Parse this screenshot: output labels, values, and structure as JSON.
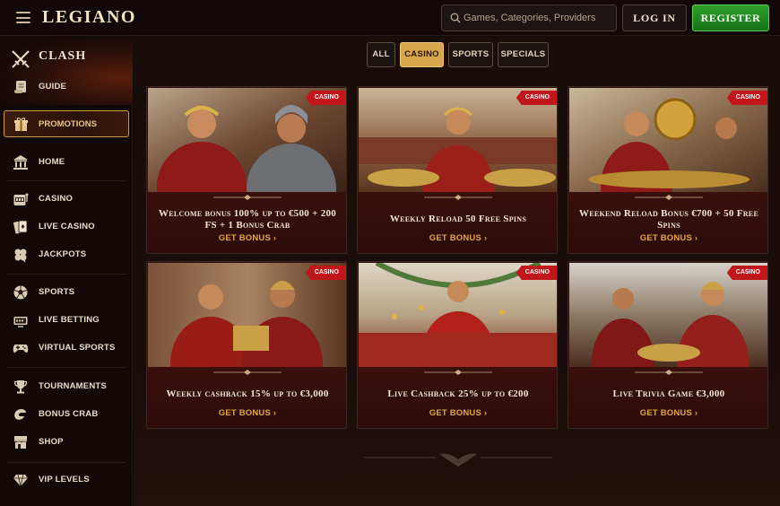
{
  "header": {
    "logo": "LEGIANO",
    "search_placeholder": "Games, Categories, Providers",
    "login_label": "LOG IN",
    "register_label": "REGISTER",
    "register_color": "#1f8a1d"
  },
  "sidebar": {
    "clash_label": "CLASH",
    "items": [
      {
        "label": "GUIDE",
        "icon": "scroll-icon"
      },
      {
        "label": "PROMOTIONS",
        "icon": "gift-icon",
        "active": true
      },
      {
        "label": "HOME",
        "icon": "temple-icon"
      },
      {
        "label": "CASINO",
        "icon": "slot-machine-icon"
      },
      {
        "label": "LIVE CASINO",
        "icon": "cards-icon"
      },
      {
        "label": "JACKPOTS",
        "icon": "clover-icon"
      },
      {
        "label": "SPORTS",
        "icon": "soccer-ball-icon"
      },
      {
        "label": "LIVE BETTING",
        "icon": "live-tv-icon"
      },
      {
        "label": "VIRTUAL SPORTS",
        "icon": "gamepad-icon"
      },
      {
        "label": "TOURNAMENTS",
        "icon": "trophy-icon"
      },
      {
        "label": "BONUS CRAB",
        "icon": "claw-icon"
      },
      {
        "label": "SHOP",
        "icon": "shop-icon"
      },
      {
        "label": "VIP LEVELS",
        "icon": "diamond-icon"
      }
    ]
  },
  "filters": [
    {
      "label": "ALL",
      "active": false
    },
    {
      "label": "CASINO",
      "active": true
    },
    {
      "label": "SPORTS",
      "active": false
    },
    {
      "label": "SPECIALS",
      "active": false
    }
  ],
  "promotions": [
    {
      "badge": "CASINO",
      "title": "Welcome bonus 100% up to €500 + 200 FS + 1 Bonus Crab",
      "cta": "GET BONUS"
    },
    {
      "badge": "CASINO",
      "title": "Weekly Reload 50 Free Spins",
      "cta": "GET BONUS"
    },
    {
      "badge": "CASINO",
      "title": "Weekend Reload Bonus €700 + 50 Free Spins",
      "cta": "GET BONUS"
    },
    {
      "badge": "CASINO",
      "title": "Weekly cashback 15% up to €3,000",
      "cta": "GET BONUS"
    },
    {
      "badge": "CASINO",
      "title": "Live Cashback 25% up to €200",
      "cta": "GET BONUS"
    },
    {
      "badge": "CASINO",
      "title": "Live Trivia Game €3,000",
      "cta": "GET BONUS"
    }
  ],
  "colors": {
    "accent_gold": "#d8a64a",
    "badge_red": "#c0161c",
    "cta_gold": "#e0a73e"
  }
}
